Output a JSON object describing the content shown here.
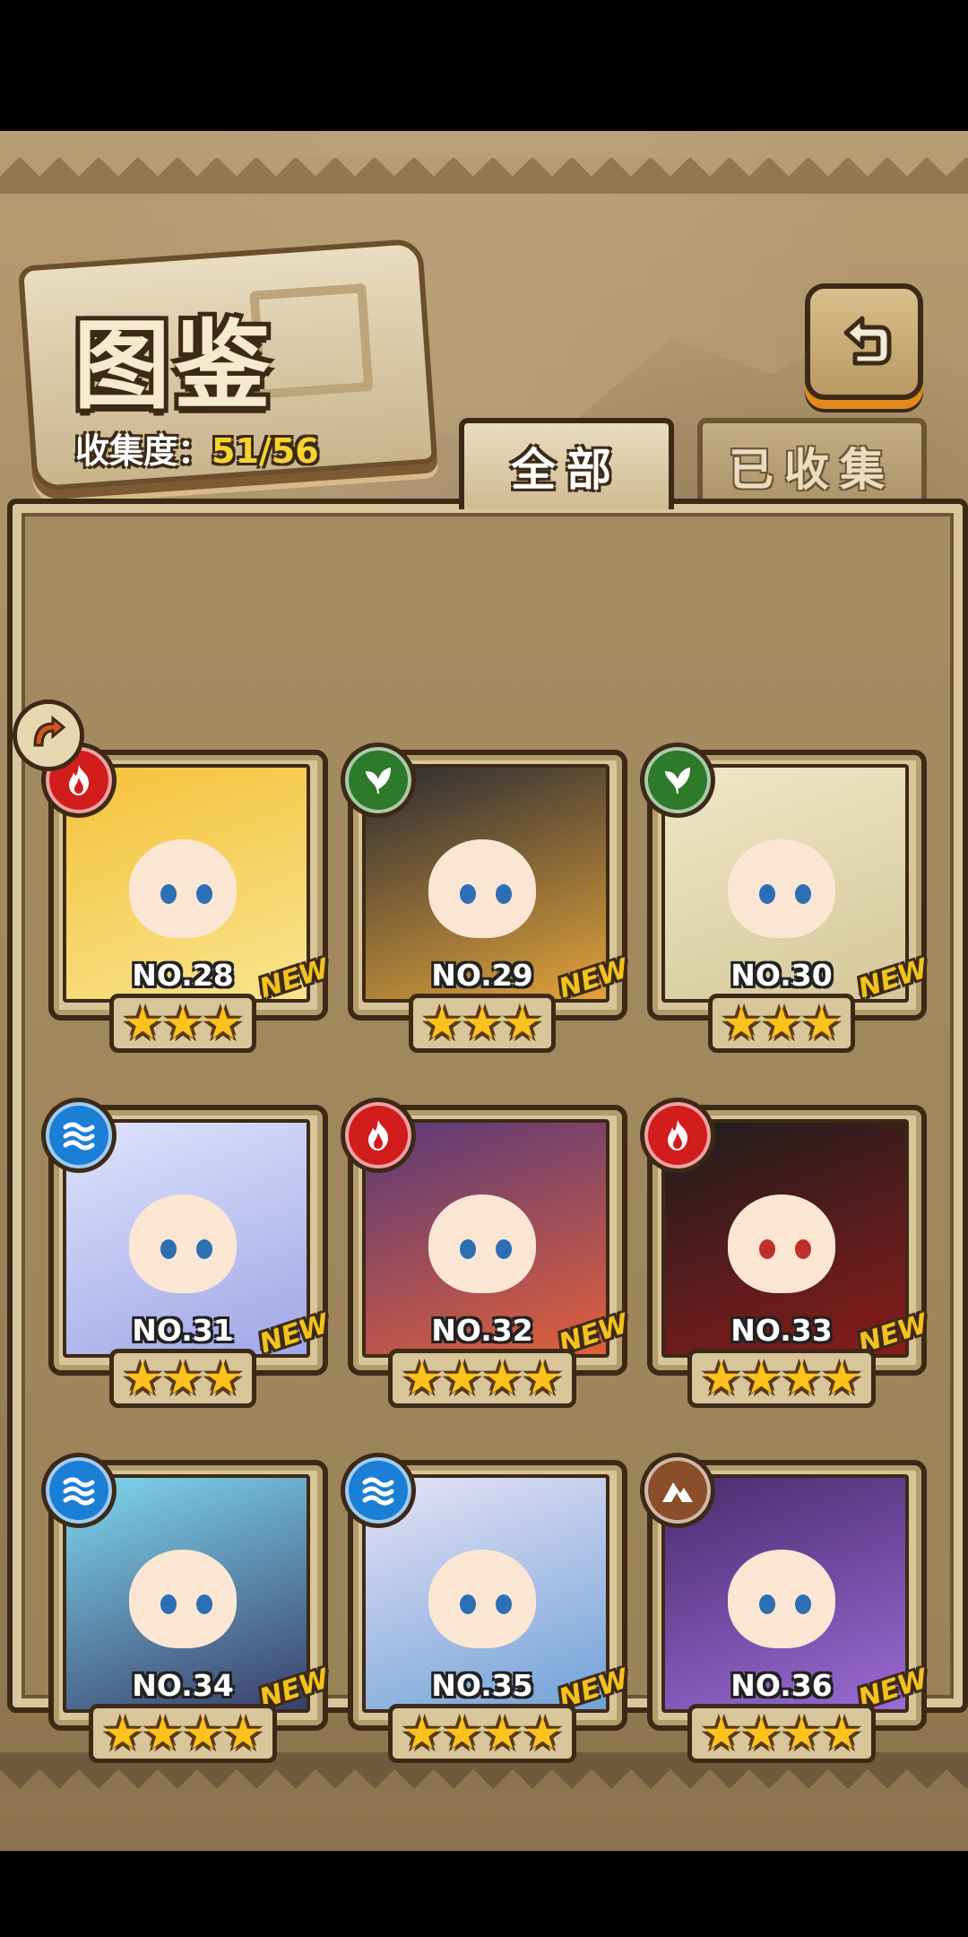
{
  "header": {
    "title": "图鉴",
    "collection_label": "收集度：",
    "collection_value": "51/56"
  },
  "tabs": [
    {
      "label": "全部",
      "active": true
    },
    {
      "label": "已收集",
      "active": false
    }
  ],
  "colors": {
    "fire": "#d21d1d",
    "wood": "#2d7a2a",
    "water": "#1b7fd6",
    "earth": "#8a4e2b",
    "star": "#ffc21d",
    "new_tag": "#f3c21c"
  },
  "cards": [
    {
      "number": "NO.28",
      "element": "fire",
      "stars": 3,
      "badge": "NEW",
      "art_colors": [
        "#f5c23a",
        "#f8e48f"
      ]
    },
    {
      "number": "NO.29",
      "element": "wood",
      "stars": 3,
      "badge": "NEW",
      "art_colors": [
        "#2b2b33",
        "#e2a33a"
      ]
    },
    {
      "number": "NO.30",
      "element": "wood",
      "stars": 3,
      "badge": "NEW",
      "art_colors": [
        "#f1e7c7",
        "#d4c79a"
      ]
    },
    {
      "number": "NO.31",
      "element": "water",
      "stars": 3,
      "badge": "NEW",
      "art_colors": [
        "#dfe3fb",
        "#9fa6e6"
      ]
    },
    {
      "number": "NO.32",
      "element": "fire",
      "stars": 4,
      "badge": "NEW",
      "art_colors": [
        "#5a3a7a",
        "#e0603a"
      ]
    },
    {
      "number": "NO.33",
      "element": "fire",
      "stars": 4,
      "badge": "NEW",
      "art_colors": [
        "#1d1d1d",
        "#8b1b1b"
      ]
    },
    {
      "number": "NO.34",
      "element": "water",
      "stars": 4,
      "badge": "NEW",
      "art_colors": [
        "#7fd8f0",
        "#3a3f6a"
      ]
    },
    {
      "number": "NO.35",
      "element": "water",
      "stars": 4,
      "badge": "NEW",
      "art_colors": [
        "#e8e2f5",
        "#6fa1d8"
      ]
    },
    {
      "number": "NO.36",
      "element": "earth",
      "stars": 4,
      "badge": "NEW",
      "art_colors": [
        "#4a2d6e",
        "#9b6ad6"
      ]
    }
  ]
}
